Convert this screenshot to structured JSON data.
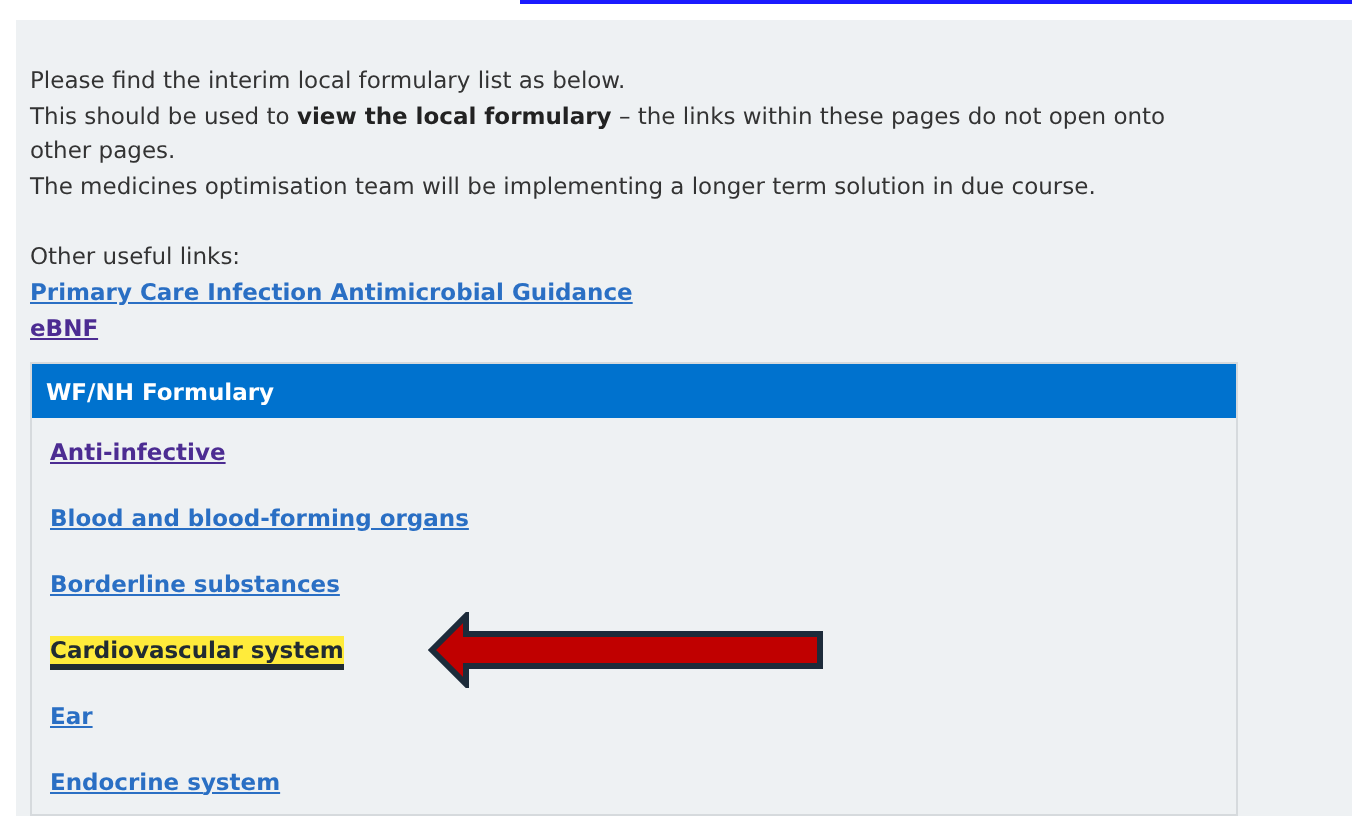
{
  "intro": [
    "Please find the interim local formulary list as below.",
    "This should be used to **view the local formulary** – the links within these pages do not open onto other pages.",
    "The medicines optimisation team will be implementing a longer term solution in due course."
  ],
  "other_links_label": "Other useful links:",
  "other_links": [
    {
      "label": "Primary Care Infection Antimicrobial Guidance",
      "visited": false
    },
    {
      "label": "eBNF",
      "visited": true
    }
  ],
  "formulary": {
    "title": "WF/NH Formulary",
    "items": [
      {
        "label": "Anti-infective",
        "visited": true,
        "highlighted": false
      },
      {
        "label": "Blood and blood-forming organs",
        "visited": false,
        "highlighted": false
      },
      {
        "label": "Borderline substances",
        "visited": false,
        "highlighted": false
      },
      {
        "label": "Cardiovascular system",
        "visited": false,
        "highlighted": true
      },
      {
        "label": "Ear",
        "visited": false,
        "highlighted": false
      },
      {
        "label": "Endocrine system",
        "visited": false,
        "highlighted": false
      }
    ]
  }
}
